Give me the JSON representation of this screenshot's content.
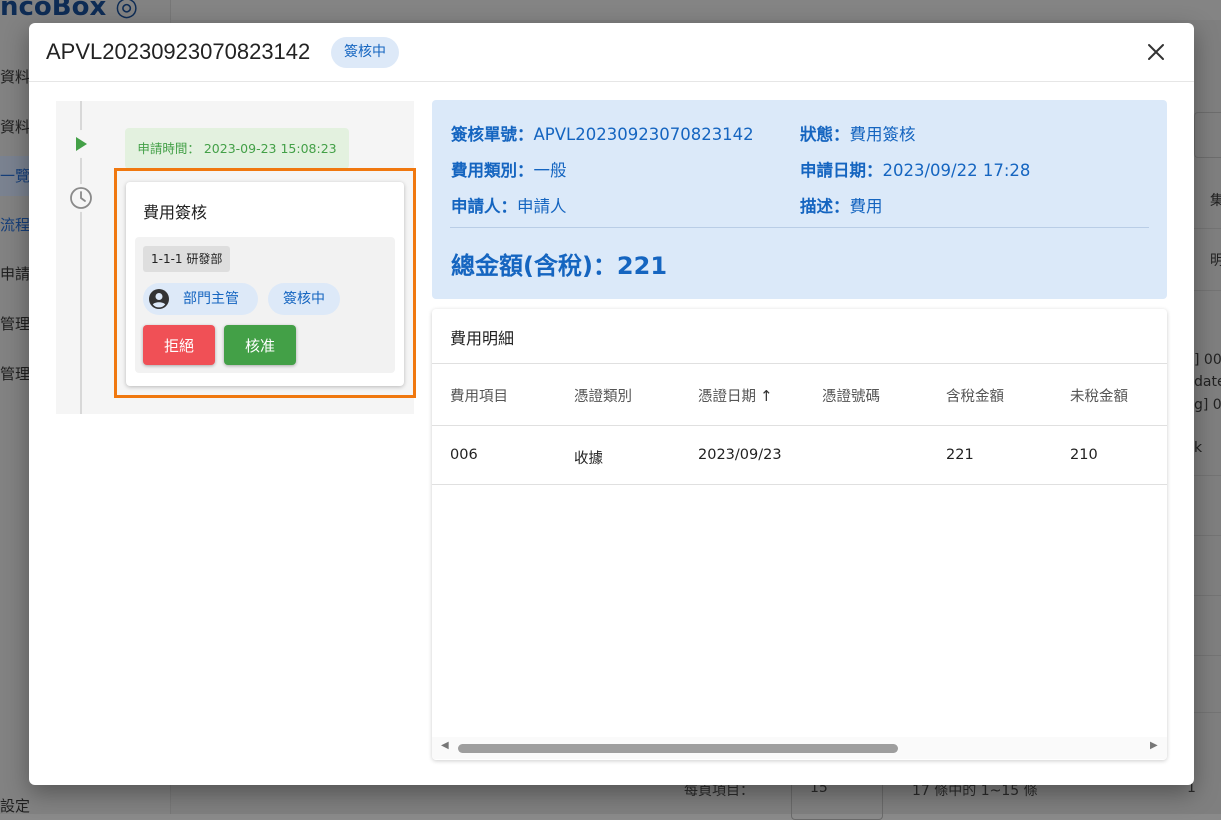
{
  "background": {
    "logo": "ncoBox ◎",
    "sidebar_items": [
      "資料",
      "資料",
      "一覽",
      "流程",
      "申請",
      "管理",
      "管理"
    ],
    "sidebar_footer": "設定",
    "right_fragments": [
      "集",
      "明",
      "] 00",
      "date",
      "g] 00",
      "k"
    ],
    "footer_per_page_label": "每頁項目：",
    "footer_per_page_value": "15",
    "footer_range": "17 條中的 1~15 條",
    "footer_page": "1"
  },
  "modal": {
    "title": "APVL20230923070823142",
    "status": "簽核中",
    "timeline": {
      "apply_time_label": "申請時間： 2023-09-23 15:08:23",
      "step": {
        "title": "費用簽核",
        "department": "1-1-1 研發部",
        "approver": "部門主管",
        "approval_status": "簽核中",
        "reject_label": "拒絕",
        "approve_label": "核准"
      }
    },
    "summary": {
      "doc_no_label": "簽核單號：",
      "doc_no": "APVL20230923070823142",
      "status_label": "狀態：",
      "status": "費用簽核",
      "category_label": "費用類別：",
      "category": "一般",
      "apply_date_label": "申請日期：",
      "apply_date": "2023/09/22 17:28",
      "applicant_label": "申請人：",
      "applicant": "申請人",
      "description_label": "描述：",
      "description": "費用",
      "total": "總金額(含稅)：221"
    },
    "detail": {
      "title": "費用明細",
      "columns": [
        "費用項目",
        "憑證類別",
        "憑證日期",
        "憑證號碼",
        "含稅金額",
        "未稅金額"
      ],
      "sort_indicator": "↑",
      "rows": [
        [
          "006",
          "收據",
          "2023/09/23",
          "",
          "221",
          "210"
        ]
      ]
    }
  },
  "colors": {
    "accent_blue": "#1565c0",
    "chip_bg": "#dde9f8",
    "reject_red": "#f05056",
    "approve_green": "#43a047",
    "highlight_orange": "#f0780f"
  }
}
